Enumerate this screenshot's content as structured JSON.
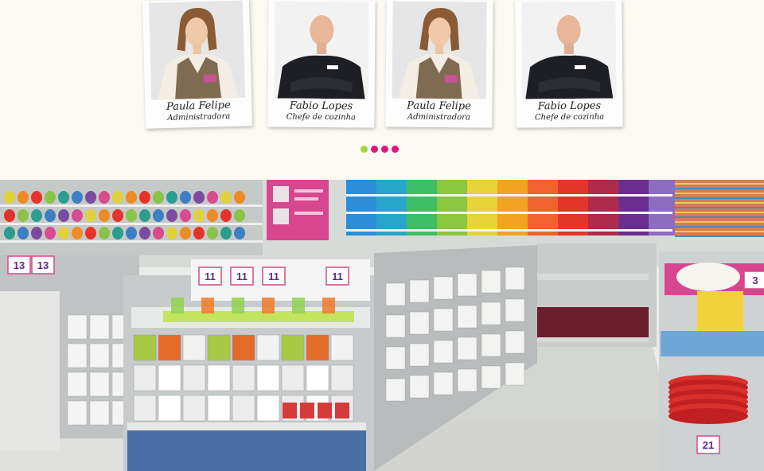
{
  "team": [
    {
      "name": "Paula Felipe",
      "role": "Administradora",
      "figure": "female-staff-apron"
    },
    {
      "name": "Fabio Lopes",
      "role": "Chefe de cozinha",
      "figure": "male-chef-black-jacket"
    },
    {
      "name": "Paula Felipe",
      "role": "Administradora",
      "figure": "female-staff-apron"
    },
    {
      "name": "Fabio Lopes",
      "role": "Chefe de cozinha",
      "figure": "male-chef-black-jacket"
    }
  ],
  "pager": {
    "count": 4,
    "active": 0
  },
  "store": {
    "price_tags": [
      "13",
      "13",
      "11",
      "11",
      "11",
      "11",
      "3",
      "21"
    ],
    "colors": {
      "pink": "#e0147a",
      "green": "#a7d63c",
      "shelf": "#c9cdd0",
      "floor": "#d9dcd8"
    }
  }
}
